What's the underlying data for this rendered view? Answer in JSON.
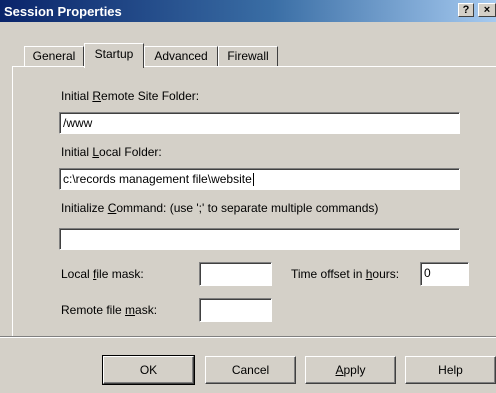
{
  "window": {
    "title": "Session Properties",
    "help_button": "?",
    "close_button": "×"
  },
  "tabs": [
    {
      "label": "General"
    },
    {
      "label": "Startup"
    },
    {
      "label": "Advanced"
    },
    {
      "label": "Firewall"
    }
  ],
  "startup": {
    "remote_folder": {
      "label_pre": "Initial ",
      "label_key": "R",
      "label_post": "emote Site Folder:",
      "value": "/www"
    },
    "local_folder": {
      "label_pre": "Initial ",
      "label_key": "L",
      "label_post": "ocal Folder:",
      "value": "c:\\records management file\\website"
    },
    "init_command": {
      "label_pre": "Initialize ",
      "label_key": "C",
      "label_post": "ommand: (use ';' to separate multiple commands)",
      "value": ""
    },
    "local_mask": {
      "label_pre": "Local ",
      "label_key": "f",
      "label_post": "ile mask:",
      "value": ""
    },
    "time_offset": {
      "label_pre": "Time offset in ",
      "label_key": "h",
      "label_post": "ours:",
      "value": "0"
    },
    "remote_mask": {
      "label_pre": "Remote file ",
      "label_key": "m",
      "label_post": "ask:",
      "value": ""
    }
  },
  "buttons": {
    "ok": "OK",
    "cancel": "Cancel",
    "apply_key": "A",
    "apply_rest": "pply",
    "help": "Help"
  }
}
